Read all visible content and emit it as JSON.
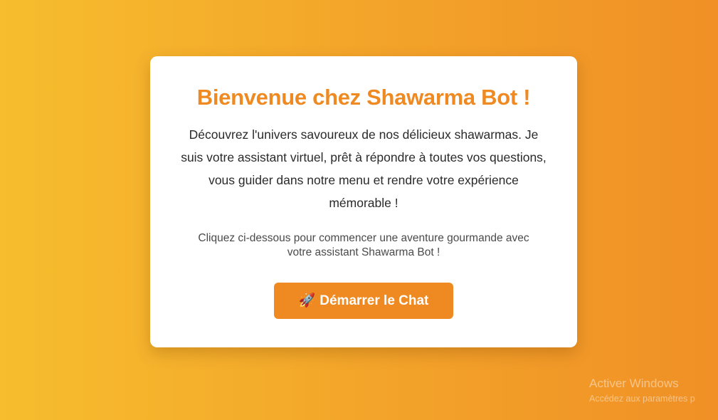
{
  "welcome": {
    "title": "Bienvenue chez Shawarma Bot !",
    "intro": "Découvrez l'univers savoureux de nos délicieux shawarmas. Je suis votre assistant virtuel, prêt à répondre à toutes vos questions, vous guider dans notre menu et rendre votre expérience mémorable !",
    "cta_text": "Cliquez ci-dessous pour commencer une aventure gourmande avec votre assistant Shawarma Bot !",
    "start_button": {
      "icon": "rocket-icon",
      "icon_glyph": "🚀",
      "label": "Démarrer le Chat"
    }
  },
  "windows_watermark": {
    "title": "Activer Windows",
    "subtitle": "Accédez aux paramètres p"
  },
  "colors": {
    "accent": "#ef8a22",
    "gradient_start": "#f7bd2e",
    "gradient_end": "#f09026",
    "card_background": "#ffffff"
  }
}
